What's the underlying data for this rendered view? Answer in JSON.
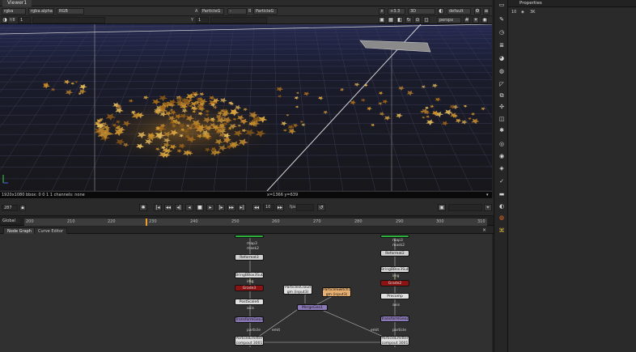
{
  "viewer": {
    "tab_label": "Viewer1",
    "toolbar1": {
      "channels": "rgba",
      "layer": "rgba.alpha",
      "display": "RGB",
      "input_a_label": "A",
      "input_a": "ParticleG",
      "input_dash": "-",
      "input_b_label": "B",
      "input_b": "ParticleG",
      "zoom": "+3.3",
      "view": "3D",
      "lut": "default"
    },
    "toolbar2": {
      "gain_label": "f/8",
      "gain": "1",
      "y_label": "Y",
      "gamma": "1",
      "proxy": "perspx"
    },
    "info": {
      "format": "1920x1080  bbox: 0 0 1 1  channels: none",
      "coords": "x=1366 y=639"
    }
  },
  "playback": {
    "frame": "287",
    "increment": "10",
    "mode_label": "fps"
  },
  "timeline": {
    "in_label": "Global",
    "ticks": [
      "200",
      "210",
      "220",
      "230",
      "240",
      "250",
      "260",
      "270",
      "280",
      "290",
      "300",
      "310"
    ]
  },
  "node_graph": {
    "tabs": [
      "Node Graph",
      "Curve Editor"
    ],
    "nodes": {
      "left_reformat": "Reformat3",
      "left_bbox": "BringBBox3Subset",
      "left_red": "Grade3",
      "left_postscale": "PostScale6",
      "left_transform": "TransformGeo3",
      "left_particle": "ParticleEmitter\ncompout 3001",
      "center_particles": "ParticlesCloud\ngm (input3)",
      "center_switch": "ParticleSwitch1\ngm (input3)",
      "center_merge": "MergeGeo1",
      "right_reformat": "Reformat2",
      "right_bbox": "BringBBox3Subset",
      "right_red": "Grade2",
      "right_precomp": "Precomp",
      "right_transform": "TransformGeo2",
      "right_particle": "ParticleEmitter\ncompout 3001"
    },
    "labels": {
      "left_top_label": "map3",
      "left_top_label2": "mask2",
      "left_mid_label": "img",
      "left_lower_label": "axis",
      "left_bottom_label": "particle",
      "right_top_label": "map3",
      "right_top_label2": "mask2",
      "right_mid_label": "img",
      "right_lower_label": "axis",
      "right_bottom_label": "particle",
      "center_emit": "emit",
      "center_emit2": "emit"
    }
  },
  "properties": {
    "tab_label": "Properties",
    "count": "10",
    "mode": "3K"
  },
  "colors": {
    "accent_green": "#2eae3c",
    "node_red": "#8a1414",
    "node_purple": "#8c7ab8",
    "node_orange": "#e8b070",
    "leaf_amber": "#c8902c"
  }
}
